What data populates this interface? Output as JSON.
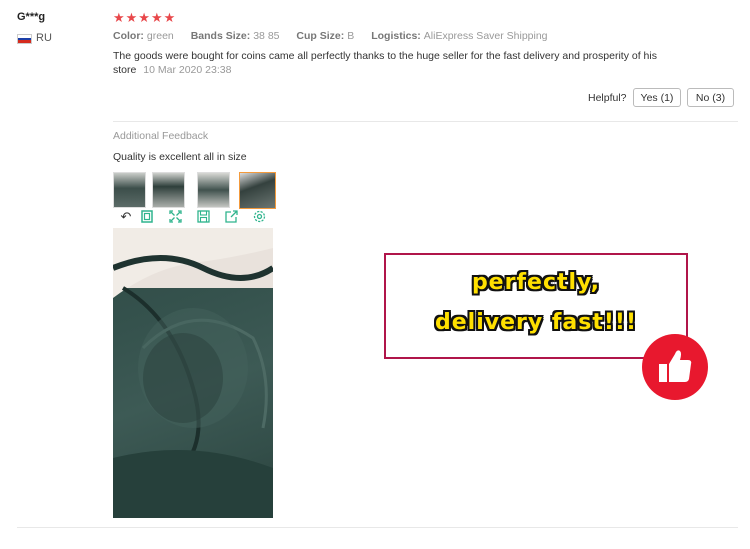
{
  "review": {
    "user_name": "G***g",
    "country": "RU",
    "rating_stars": "★★★★★",
    "attributes": [
      {
        "label": "Color:",
        "value": "green"
      },
      {
        "label": "Bands Size:",
        "value": "38 85"
      },
      {
        "label": "Cup Size:",
        "value": "B"
      },
      {
        "label": "Logistics:",
        "value": "AliExpress Saver Shipping"
      }
    ],
    "text": "The goods were bought for coins came all perfectly thanks to the huge seller for the fast delivery and prosperity of his store",
    "date": "10 Mar 2020 23:38",
    "helpful_label": "Helpful?",
    "yes_label": "Yes (1)",
    "no_label": "No (3)"
  },
  "additional_feedback": {
    "title": "Additional Feedback",
    "text": "Quality is excellent all in size"
  },
  "overlay": {
    "line1": "perfectly,",
    "line2": "delivery fast!!!"
  },
  "colors": {
    "star": "#e8474a",
    "tool_icons": "#2fb48d",
    "overlay_border": "#b0154a",
    "overlay_text": "#ffe000",
    "thumbs_badge": "#e8182e"
  },
  "icons": [
    "rotate-icon",
    "fit-icon",
    "expand-icon",
    "save-icon",
    "share-icon",
    "settings-icon",
    "thumbs-up-icon"
  ]
}
